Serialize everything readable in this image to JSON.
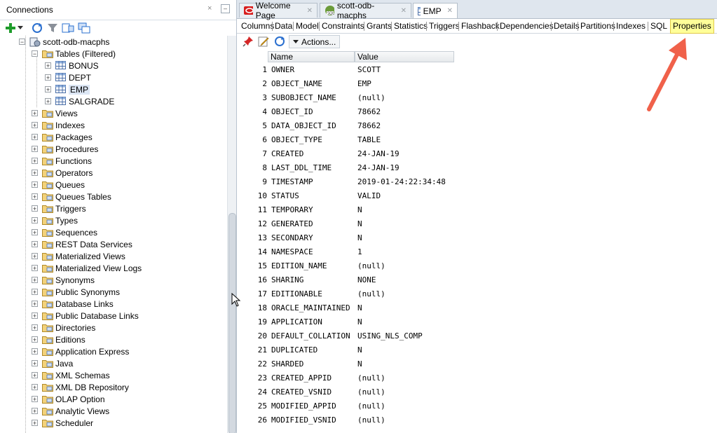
{
  "left_panel": {
    "title": "Connections",
    "close_glyph": "×",
    "minimize_glyph": "–"
  },
  "tree": {
    "connection": "scott-odb-macphs",
    "tables_label": "Tables (Filtered)",
    "tables": [
      "BONUS",
      "DEPT",
      "EMP",
      "SALGRADE"
    ],
    "nodes": [
      "Views",
      "Indexes",
      "Packages",
      "Procedures",
      "Functions",
      "Operators",
      "Queues",
      "Queues Tables",
      "Triggers",
      "Types",
      "Sequences",
      "REST Data Services",
      "Materialized Views",
      "Materialized View Logs",
      "Synonyms",
      "Public Synonyms",
      "Database Links",
      "Public Database Links",
      "Directories",
      "Editions",
      "Application Express",
      "Java",
      "XML Schemas",
      "XML DB Repository",
      "OLAP Option",
      "Analytic Views",
      "Scheduler"
    ]
  },
  "doc_tabs": [
    {
      "label": "Welcome Page",
      "icon": "oracle-icon"
    },
    {
      "label": "scott-odb-macphs",
      "icon": "sql-worksheet-icon"
    },
    {
      "label": "EMP",
      "icon": "table-icon"
    }
  ],
  "sub_tabs": [
    "Columns",
    "Data",
    "Model",
    "Constraints",
    "Grants",
    "Statistics",
    "Triggers",
    "Flashback",
    "Dependencies",
    "Details",
    "Partitions",
    "Indexes",
    "SQL",
    "Properties"
  ],
  "active_sub_tab": "Properties",
  "toolbar": {
    "actions_label": "Actions..."
  },
  "grid": {
    "columns": [
      "Name",
      "Value"
    ],
    "rows": [
      [
        "1",
        "OWNER",
        "SCOTT"
      ],
      [
        "2",
        "OBJECT_NAME",
        "EMP"
      ],
      [
        "3",
        "SUBOBJECT_NAME",
        "(null)"
      ],
      [
        "4",
        "OBJECT_ID",
        "78662"
      ],
      [
        "5",
        "DATA_OBJECT_ID",
        "78662"
      ],
      [
        "6",
        "OBJECT_TYPE",
        "TABLE"
      ],
      [
        "7",
        "CREATED",
        "24-JAN-19"
      ],
      [
        "8",
        "LAST_DDL_TIME",
        "24-JAN-19"
      ],
      [
        "9",
        "TIMESTAMP",
        "2019-01-24:22:34:48"
      ],
      [
        "10",
        "STATUS",
        "VALID"
      ],
      [
        "11",
        "TEMPORARY",
        "N"
      ],
      [
        "12",
        "GENERATED",
        "N"
      ],
      [
        "13",
        "SECONDARY",
        "N"
      ],
      [
        "14",
        "NAMESPACE",
        "1"
      ],
      [
        "15",
        "EDITION_NAME",
        "(null)"
      ],
      [
        "16",
        "SHARING",
        "NONE"
      ],
      [
        "17",
        "EDITIONABLE",
        "(null)"
      ],
      [
        "18",
        "ORACLE_MAINTAINED",
        "N"
      ],
      [
        "19",
        "APPLICATION",
        "N"
      ],
      [
        "20",
        "DEFAULT_COLLATION",
        "USING_NLS_COMP"
      ],
      [
        "21",
        "DUPLICATED",
        "N"
      ],
      [
        "22",
        "SHARDED",
        "N"
      ],
      [
        "23",
        "CREATED_APPID",
        "(null)"
      ],
      [
        "24",
        "CREATED_VSNID",
        "(null)"
      ],
      [
        "25",
        "MODIFIED_APPID",
        "(null)"
      ],
      [
        "26",
        "MODIFIED_VSNID",
        "(null)"
      ]
    ]
  },
  "colors": {
    "highlight": "#ffff99",
    "arrow": "#f0614a",
    "selection": "#dce6f4"
  }
}
